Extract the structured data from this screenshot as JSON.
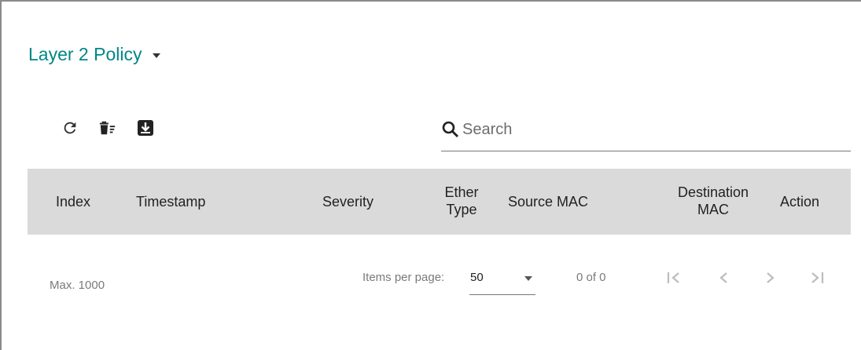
{
  "header": {
    "title": "Layer 2 Policy"
  },
  "toolbar": {
    "icons": [
      "refresh-icon",
      "delete-sweep-icon",
      "export-icon"
    ]
  },
  "search": {
    "placeholder": "Search",
    "value": ""
  },
  "table": {
    "columns": {
      "index": "Index",
      "timestamp": "Timestamp",
      "severity": "Severity",
      "ether_type_1": "Ether",
      "ether_type_2": "Type",
      "source_mac": "Source MAC",
      "destination_mac_1": "Destination",
      "destination_mac_2": "MAC",
      "action": "Action"
    },
    "rows": []
  },
  "footer": {
    "max": "Max. 1000",
    "items_per_page_label": "Items per page:",
    "items_per_page_value": "50",
    "range": "0 of 0"
  },
  "colors": {
    "accent": "#008787",
    "header_bg": "#dadada",
    "pager_disabled": "#bdbdbd"
  }
}
